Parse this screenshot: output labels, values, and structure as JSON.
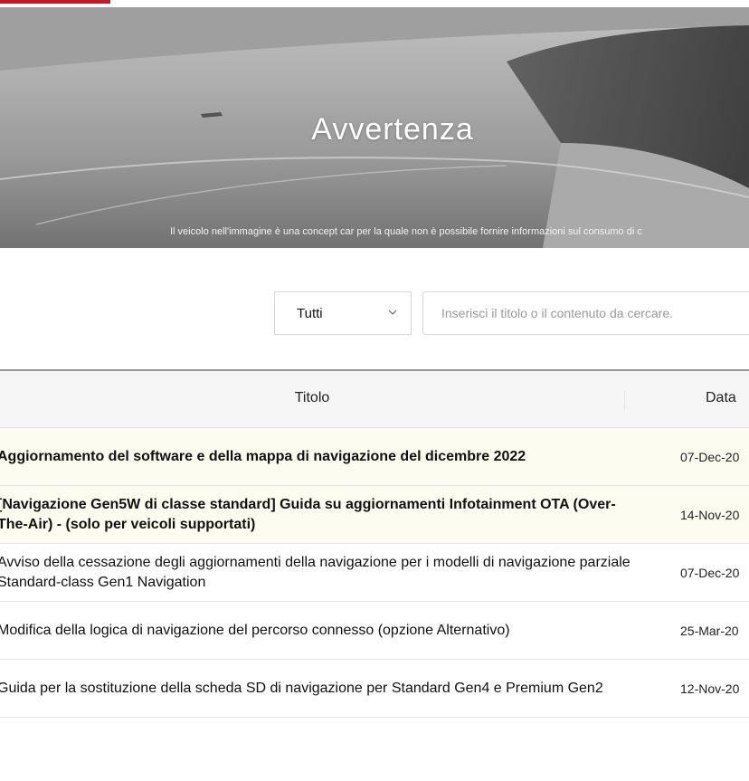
{
  "hero": {
    "title": "Avvertenza",
    "caption": "Il veicolo nell'immagine è una concept car per la quale non è possibile fornire informazioni sul consumo di c"
  },
  "filter": {
    "select_value": "Tutti",
    "search_placeholder": "Inserisci il titolo o il contenuto da cercare.",
    "search_value": ""
  },
  "table": {
    "headers": {
      "title": "Titolo",
      "date": "Data"
    },
    "rows": [
      {
        "title": "Aggiornamento del software e della mappa di navigazione del dicembre 2022",
        "date": "07-Dec-20",
        "notice": true
      },
      {
        "title": "[Navigazione Gen5W di classe standard] Guida su aggiornamenti Infotainment OTA (Over-The-Air) - (solo per veicoli supportati)",
        "date": "14-Nov-20",
        "notice": true
      },
      {
        "title": "Avviso della cessazione degli aggiornamenti della navigazione per i modelli di navigazione parziale Standard-class Gen1 Navigation",
        "date": "07-Dec-20",
        "notice": false
      },
      {
        "title": "Modifica della logica di navigazione del percorso connesso (opzione Alternativo)",
        "date": "25-Mar-20",
        "notice": false
      },
      {
        "title": "Guida per la sostituzione della scheda SD di navigazione per Standard Gen4 e Premium Gen2",
        "date": "12-Nov-20",
        "notice": false
      }
    ]
  },
  "colors": {
    "accent": "#c4172c",
    "notice_row_bg": "#fdfcf0",
    "header_bg": "#f6f6f6"
  }
}
